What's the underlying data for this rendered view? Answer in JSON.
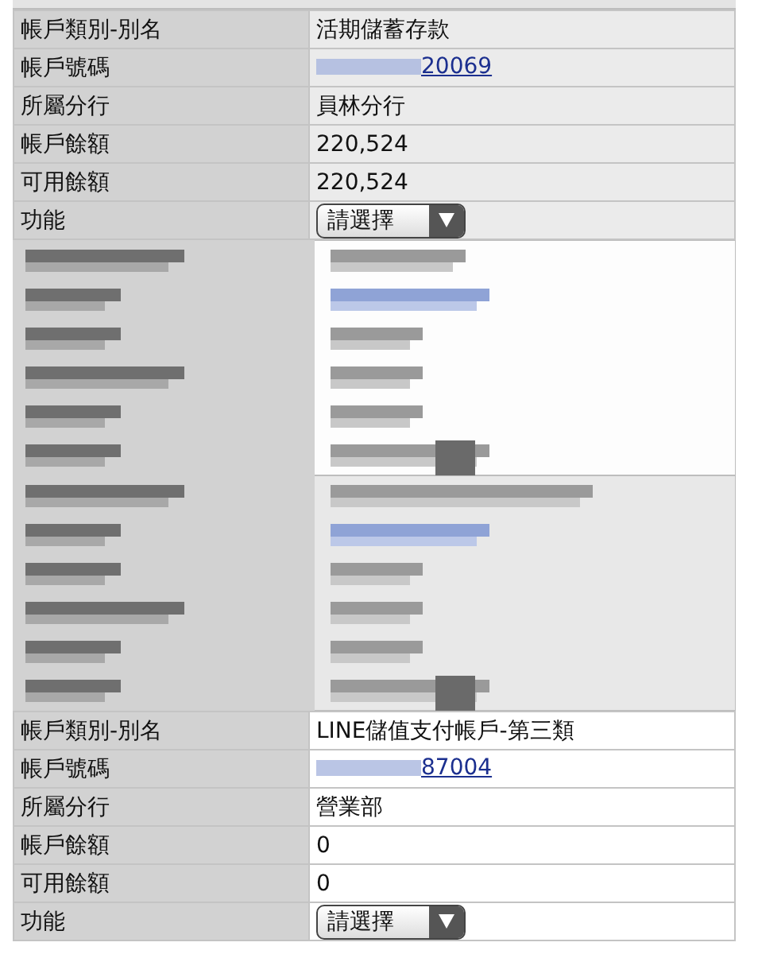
{
  "accounts": [
    {
      "kind": "account",
      "shaded": true,
      "fields": [
        {
          "kind": "text",
          "label": "帳戶類別-別名",
          "value": "活期儲蓄存款"
        },
        {
          "kind": "link",
          "label": "帳戶號碼",
          "value": "20069"
        },
        {
          "kind": "text",
          "label": "所屬分行",
          "value": "員林分行"
        },
        {
          "kind": "text",
          "label": "帳戶餘額",
          "value": "220,524"
        },
        {
          "kind": "text",
          "label": "可用餘額",
          "value": "220,524"
        },
        {
          "kind": "select",
          "label": "功能",
          "value": "請選擇"
        }
      ]
    },
    {
      "kind": "redacted",
      "shaded": false
    },
    {
      "kind": "redacted",
      "shaded": true
    },
    {
      "kind": "account",
      "shaded": false,
      "fields": [
        {
          "kind": "text",
          "label": "帳戶類別-別名",
          "value": "LINE儲值支付帳戶-第三類"
        },
        {
          "kind": "link",
          "label": "帳戶號碼",
          "value": "87004"
        },
        {
          "kind": "text",
          "label": "所屬分行",
          "value": "營業部"
        },
        {
          "kind": "text",
          "label": "帳戶餘額",
          "value": "0"
        },
        {
          "kind": "text",
          "label": "可用餘額",
          "value": "0"
        },
        {
          "kind": "select",
          "label": "功能",
          "value": "請選擇"
        }
      ]
    }
  ]
}
